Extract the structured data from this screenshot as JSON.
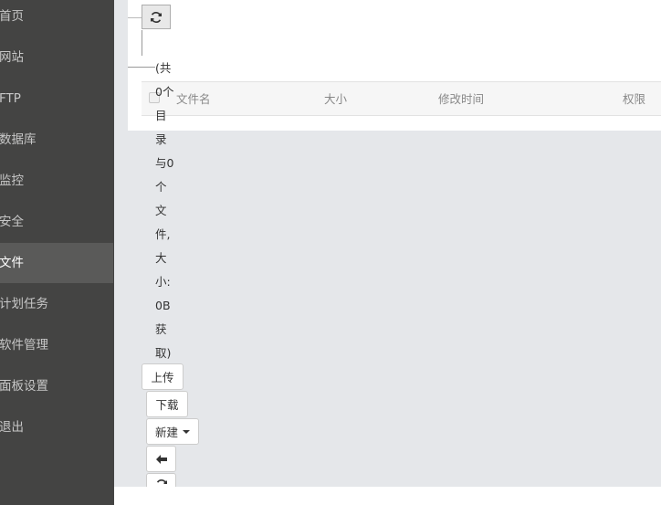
{
  "sidebar": {
    "items": [
      {
        "label": "首页"
      },
      {
        "label": "网站"
      },
      {
        "label": "FTP"
      },
      {
        "label": "数据库"
      },
      {
        "label": "监控"
      },
      {
        "label": "安全"
      },
      {
        "label": "文件",
        "active": true
      },
      {
        "label": "计划任务"
      },
      {
        "label": "软件管理"
      },
      {
        "label": "面板设置"
      },
      {
        "label": "退出"
      }
    ]
  },
  "file_table": {
    "columns": [
      "文件名",
      "大小",
      "修改时间",
      "权限"
    ]
  },
  "summary": "(共0个目录与0个文件,大小:0B获取)",
  "toolbar": {
    "upload": "上传",
    "download": "下载",
    "new": "新建"
  },
  "icons": {
    "refresh": "refresh-icon",
    "back": "arrow-left-icon",
    "new_caret": "caret-down-icon"
  },
  "colors": {
    "sidebar_bg": "#444443",
    "sidebar_active": "#5a5a59",
    "main_bg": "#e5e7ea"
  }
}
